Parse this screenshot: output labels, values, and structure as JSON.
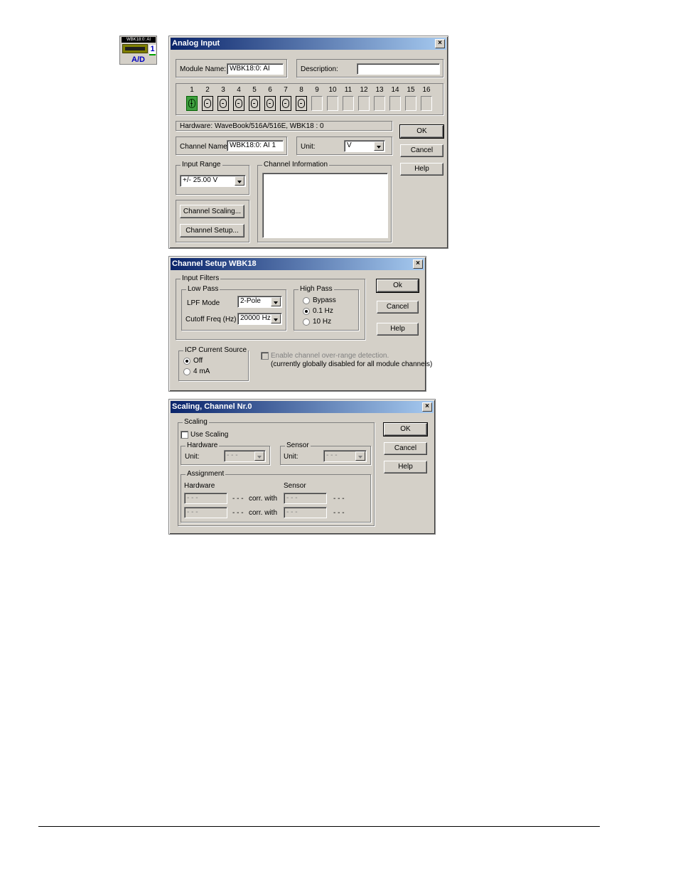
{
  "module_icon": {
    "top_label": "WBK18:0: AI",
    "badge": "1",
    "bottom_label": "A/D"
  },
  "analog_input": {
    "title": "Analog Input",
    "close": "×",
    "module_name_label": "Module Name:",
    "module_name_value": "WBK18:0: AI",
    "description_label": "Description:",
    "description_value": "",
    "channels": [
      "1",
      "2",
      "3",
      "4",
      "5",
      "6",
      "7",
      "8",
      "9",
      "10",
      "11",
      "12",
      "13",
      "14",
      "15",
      "16"
    ],
    "hardware_label": "Hardware:",
    "hardware_value": "WaveBook/516A/516E, WBK18 : 0",
    "channel_name_label": "Channel Name:",
    "channel_name_value": "WBK18:0: AI 1",
    "unit_label": "Unit:",
    "unit_value": "V",
    "input_range_label": "Input Range",
    "input_range_value": "+/- 25.00 V",
    "channel_info_label": "Channel Information",
    "channel_scaling_button": "Channel Scaling...",
    "channel_setup_button": "Channel Setup...",
    "ok": "OK",
    "cancel": "Cancel",
    "help": "Help"
  },
  "channel_setup": {
    "title": "Channel Setup WBK18",
    "close": "×",
    "input_filters_label": "Input Filters",
    "low_pass_label": "Low Pass",
    "lpf_mode_label": "LPF Mode",
    "lpf_mode_value": "2-Pole",
    "cutoff_label": "Cutoff Freq (Hz)",
    "cutoff_value": "20000 Hz",
    "high_pass_label": "High Pass",
    "hp_options": [
      "Bypass",
      "0.1 Hz",
      "10 Hz"
    ],
    "hp_selected": "0.1 Hz",
    "icp_label": "ICP Current Source",
    "icp_options": [
      "Off",
      "4 mA"
    ],
    "icp_selected": "Off",
    "overrange_label": "Enable channel over-range detection.",
    "overrange_note": "(currently globally disabled for all module channels)",
    "ok": "Ok",
    "cancel": "Cancel",
    "help": "Help"
  },
  "scaling": {
    "title": "Scaling, Channel Nr.0",
    "close": "×",
    "scaling_label": "Scaling",
    "use_scaling_label": "Use Scaling",
    "hardware_label": "Hardware",
    "hw_unit_label": "Unit:",
    "hw_unit_value": "- - -",
    "sensor_label": "Sensor",
    "sensor_unit_label": "Unit:",
    "sensor_unit_value": "- - -",
    "assignment_label": "Assignment",
    "assign_hw_label": "Hardware",
    "assign_sensor_label": "Sensor",
    "row1_hw": "- - -",
    "row1_hw_unit": "- - -",
    "row1_corr": "corr. with",
    "row1_sensor": "- - -",
    "row1_sensor_unit": "- - -",
    "row2_hw": "- - -",
    "row2_hw_unit": "- - -",
    "row2_corr": "corr. with",
    "row2_sensor": "- - -",
    "row2_sensor_unit": "- - -",
    "ok": "OK",
    "cancel": "Cancel",
    "help": "Help"
  }
}
